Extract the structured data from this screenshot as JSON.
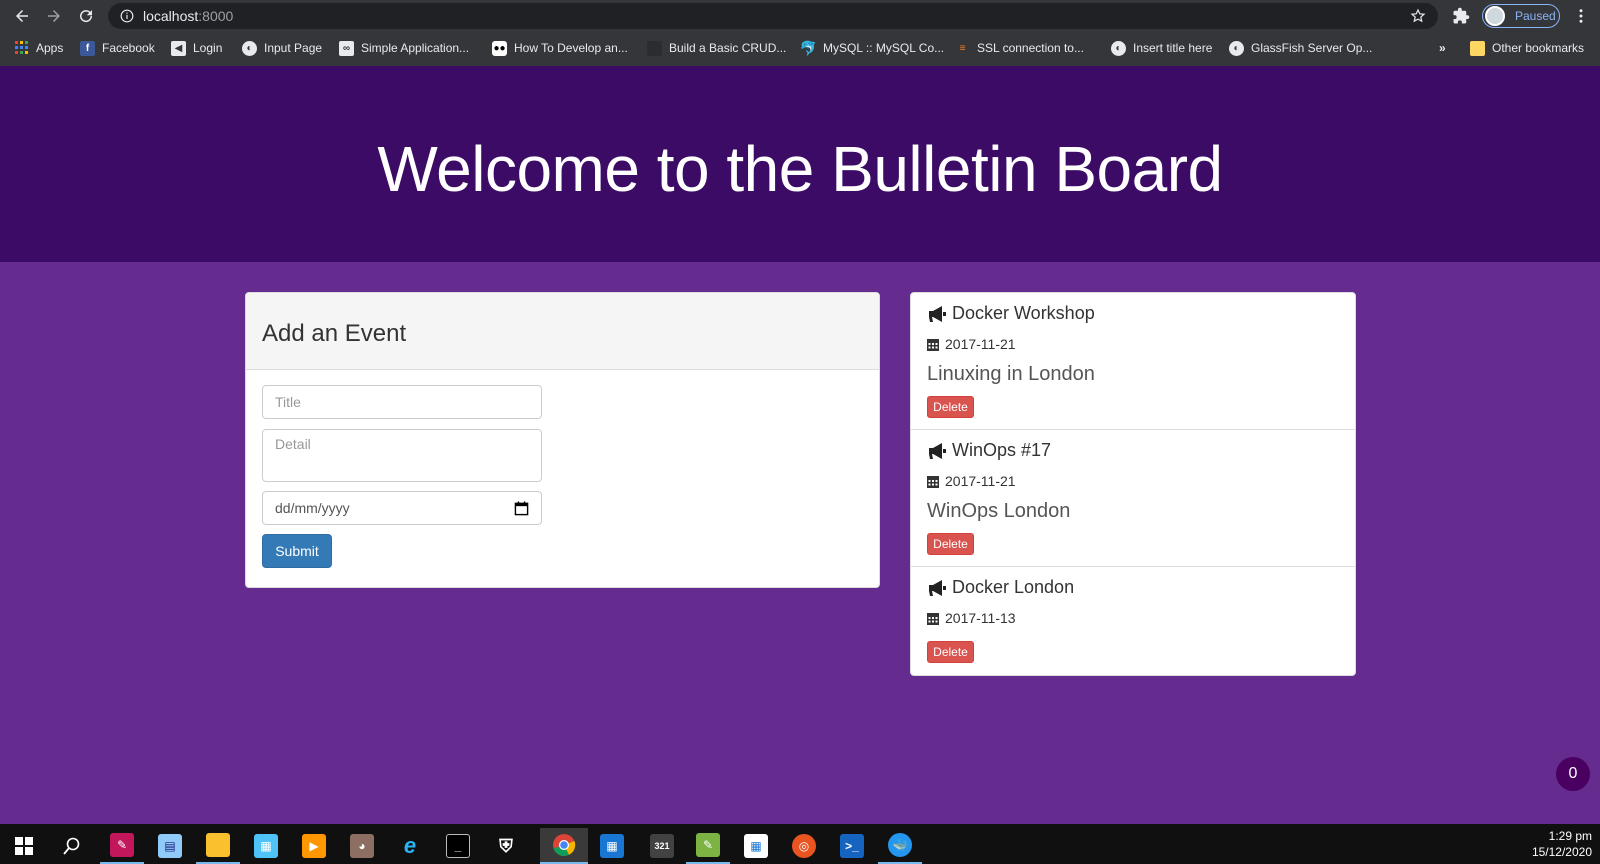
{
  "browser": {
    "url_host": "localhost",
    "url_port": ":8000",
    "profile_label": "Paused",
    "bookmarks": [
      {
        "label": "Apps",
        "icon": "apps-grid-icon"
      },
      {
        "label": "Facebook",
        "icon": "facebook-icon"
      },
      {
        "label": "Login",
        "icon": "login-icon"
      },
      {
        "label": "Input Page",
        "icon": "globe-icon"
      },
      {
        "label": "Simple Application...",
        "icon": "infinity-icon"
      },
      {
        "label": "How To Develop an...",
        "icon": "medium-icon"
      },
      {
        "label": "Build a Basic CRUD...",
        "icon": "site-icon"
      },
      {
        "label": "MySQL :: MySQL Co...",
        "icon": "mysql-icon"
      },
      {
        "label": "SSL connection to...",
        "icon": "stackoverflow-icon"
      },
      {
        "label": "Insert title here",
        "icon": "globe-icon"
      },
      {
        "label": "GlassFish Server Op...",
        "icon": "globe-icon"
      }
    ],
    "overflow_label": "»",
    "other_bookmarks": "Other bookmarks"
  },
  "header": {
    "title": "Welcome to the Bulletin Board"
  },
  "form": {
    "heading": "Add an Event",
    "title_placeholder": "Title",
    "detail_placeholder": "Detail",
    "date_placeholder": "dd/mm/yyyy",
    "submit_label": "Submit"
  },
  "events": [
    {
      "title": "Docker Workshop",
      "date": "2017-11-21",
      "detail": "Linuxing in London",
      "delete_label": "Delete"
    },
    {
      "title": "WinOps #17",
      "date": "2017-11-21",
      "detail": "WinOps London",
      "delete_label": "Delete"
    },
    {
      "title": "Docker London",
      "date": "2017-11-13",
      "detail": "",
      "delete_label": "Delete"
    }
  ],
  "floating_badge": "0",
  "taskbar": {
    "time": "1:29 pm",
    "date": "15/12/2020"
  },
  "colors": {
    "header_bg": "#3b0b66",
    "page_bg": "#652b8f",
    "submit": "#337ab7",
    "delete": "#d9534f"
  }
}
